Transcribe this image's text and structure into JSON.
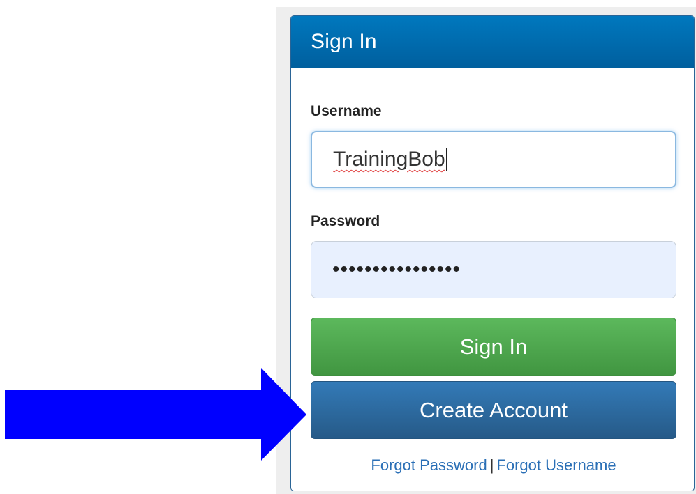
{
  "panel": {
    "title": "Sign In"
  },
  "form": {
    "username": {
      "label": "Username",
      "value": "TrainingBob"
    },
    "password": {
      "label": "Password",
      "masked_value": "••••••••••••••••"
    },
    "sign_in_button": "Sign In",
    "create_account_button": "Create Account"
  },
  "links": {
    "forgot_password": "Forgot Password",
    "separator": "|",
    "forgot_username": "Forgot Username"
  },
  "annotation": {
    "icon": "arrow-right-icon",
    "color": "#0000ff"
  },
  "colors": {
    "header_blue": "#0078be",
    "sign_in_green": "#5cb85c",
    "create_account_blue": "#337ab7",
    "link_blue": "#2a6fb6",
    "password_bg": "#e8f0fe"
  }
}
